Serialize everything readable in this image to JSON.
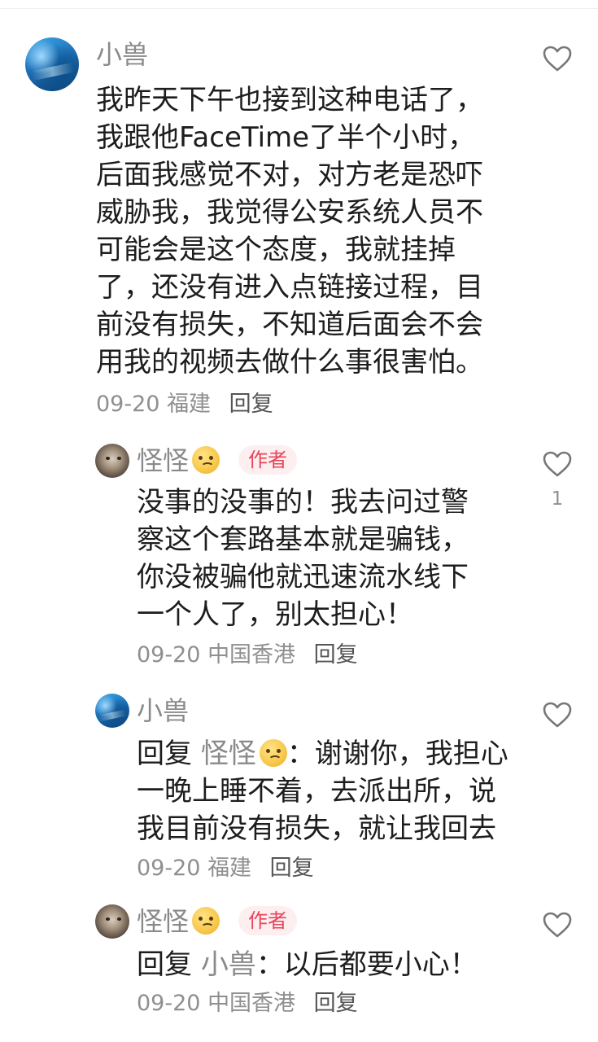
{
  "comments": [
    {
      "user": "小兽",
      "text": "我昨天下午也接到这种电话了，我跟他FaceTime了半个小时，后面我感觉不对，对方老是恐吓威胁我，我觉得公安系统人员不可能会是这个态度，我就挂掉了，还没有进入点链接过程，目前没有损失，不知道后面会不会用我的视频去做什么事很害怕。",
      "date": "09-20",
      "location": "福建",
      "reply_label": "回复",
      "likes": ""
    }
  ],
  "replies": [
    {
      "user": "怪怪",
      "emoji": "🥴",
      "badge": "作者",
      "text": "没事的没事的！我去问过警察这个套路基本就是骗钱，你没被骗他就迅速流水线下一个人了，别太担心！",
      "date": "09-20",
      "location": "中国香港",
      "reply_label": "回复",
      "likes": "1"
    },
    {
      "user": "小兽",
      "reply_prefix": "回复",
      "reply_to": "怪怪",
      "reply_to_emoji": "🥴",
      "text": "：谢谢你，我担心一晚上睡不着，去派出所，说我目前没有损失，就让我回去",
      "date": "09-20",
      "location": "福建",
      "reply_label": "回复",
      "likes": ""
    },
    {
      "user": "怪怪",
      "emoji": "🥴",
      "badge": "作者",
      "reply_prefix": "回复",
      "reply_to": "小兽",
      "text": "：以后都要小心！",
      "date": "09-20",
      "location": "中国香港",
      "reply_label": "回复",
      "likes": ""
    }
  ],
  "icons": {
    "like": "heart-outline-icon",
    "emoji": "woozy-face-emoji"
  },
  "colors": {
    "author_badge_text": "#e8445a",
    "author_badge_bg": "#fdeff0",
    "secondary_text": "#8a8a8a",
    "primary_text": "#1d1d1d"
  }
}
